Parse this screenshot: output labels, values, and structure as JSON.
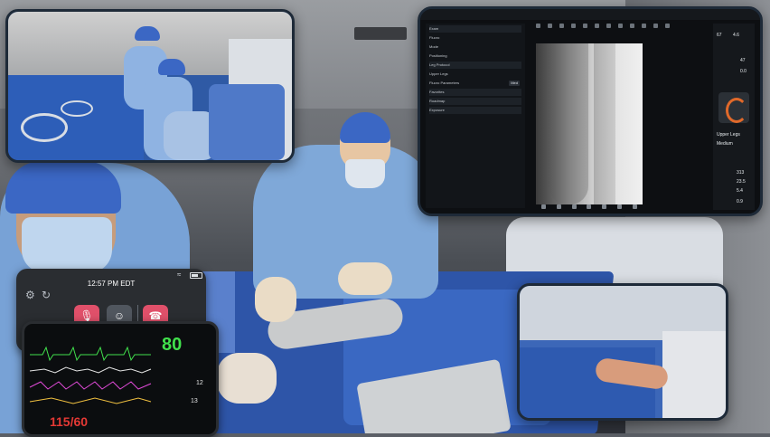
{
  "call_panel": {
    "time": "12:57 PM EDT",
    "buttons": [
      "mute-mic",
      "participants",
      "end-call"
    ]
  },
  "vitals": {
    "heart_rate": "80",
    "blood_pressure": "115/60",
    "small_readout_1": "12",
    "small_readout_2": "13"
  },
  "imaging_app": {
    "left_panel": {
      "header": "Exam",
      "rows": [
        {
          "label": "Fluoro",
          "value": ""
        },
        {
          "label": "Mode",
          "value": ""
        },
        {
          "label": "Positioning",
          "value": ""
        },
        {
          "label": "Leg Protocol",
          "value": ""
        },
        {
          "label": "Upper Legs",
          "value": ""
        },
        {
          "label": "Fluoro Parameters",
          "value": "Med"
        },
        {
          "label": "Favorites",
          "value": ""
        },
        {
          "label": "Roadmap",
          "value": ""
        },
        {
          "label": "Exposure",
          "value": ""
        }
      ]
    },
    "right_panel": {
      "kv": "67",
      "ma": "4.6",
      "val_a": "47",
      "val_b": "0.0",
      "procedure": "Upper Legs",
      "mode": "Medium",
      "stat_1": "313",
      "stat_2": "23.5",
      "stat_3": "5.4",
      "stat_4": "0.9"
    }
  },
  "colors": {
    "heart_rate": "#41e04c",
    "blood_pressure": "#e53935",
    "call_button": "#e0506a",
    "gantry_accent": "#e1692a"
  }
}
